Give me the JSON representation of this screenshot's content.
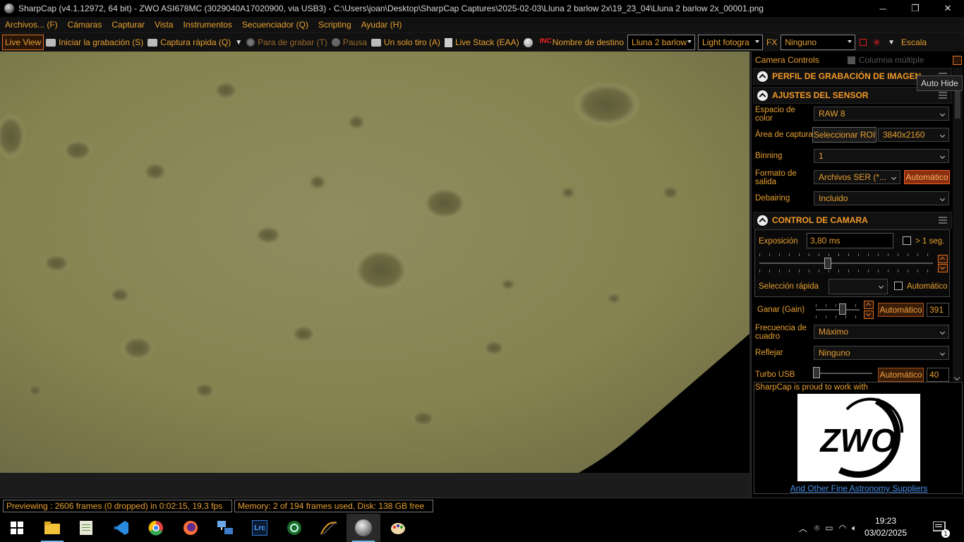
{
  "window": {
    "title": "SharpCap (v4.1.12972, 64 bit) - ZWO ASI678MC (3029040A17020900, via USB3) - C:\\Users\\joan\\Desktop\\SharpCap Captures\\2025-02-03\\Lluna 2 barlow 2x\\19_23_04\\Lluna 2 barlow 2x_00001.png",
    "minimize": "─",
    "maximize": "❐",
    "close": "✕"
  },
  "menu": [
    "Archivos... (F)",
    "Cámaras",
    "Capturar",
    "Vista",
    "Instrumentos",
    "Secuenciador (Q)",
    "Scripting",
    "Ayudar (H)"
  ],
  "toolbar": {
    "live_view": "Live View",
    "start_recording": "Iniciar la grabación (S)",
    "quick_capture": "Captura rápida (Q)",
    "stop_recording": "Para de grabar (T)",
    "pause": "Pausa",
    "single_shot": "Un solo tiro (A)",
    "live_stack": "Live Stack (EAA)",
    "target_name_label": "Nombre de destino",
    "target_name_value": "Lluna 2 barlow",
    "capture_profile": "Light fotogra",
    "fx_label": "FX",
    "fx_value": "Ninguno",
    "scale_label": "Escala"
  },
  "panel": {
    "title": "Camera Controls",
    "multi_column": "Columna múltiple",
    "auto_hide_tooltip": "Auto Hide",
    "sections": {
      "capture_profile": "PERFIL DE GRABACIÓN DE IMAGEN",
      "sensor": "AJUSTES DEL SENSOR",
      "camera_control": "CONTROL DE CAMARA"
    },
    "sensor": {
      "color_space_label": "Espacio de color",
      "color_space_value": "RAW 8",
      "capture_area_label": "Área de captura",
      "select_roi": "Seleccionar ROI",
      "capture_area_value": "3840x2160",
      "binning_label": "Binning",
      "binning_value": "1",
      "output_format_label": "Formato de salida",
      "output_format_value": "Archivos SER (*...",
      "output_auto": "Automático",
      "debayer_label": "Debairing",
      "debayer_value": "Incluido"
    },
    "camera": {
      "exposure_label": "Exposición",
      "exposure_value": "3,80 ms",
      "over_1s": "> 1 seg.",
      "quick_select_label": "Selección rápida",
      "quick_select_value": "",
      "quick_select_auto": "Automático",
      "gain_label": "Ganar (Gain)",
      "gain_auto": "Automático",
      "gain_value": "391",
      "frame_rate_label": "Frecuencia de cuadro",
      "frame_rate_value": "Máximo",
      "flip_label": "Reflejar",
      "flip_value": "Ninguno",
      "usb_turbo_label": "Turbo USB",
      "usb_turbo_auto": "Automático",
      "usb_turbo_value": "40"
    },
    "sponsor": {
      "proud": "SharpCap is proud to work with",
      "logo_text": "ZWO",
      "link": "And Other Fine Astronomy Suppliers"
    }
  },
  "status": {
    "previewing": "Previewing : 2606 frames (0 dropped) in 0:02:15, 19,3 fps",
    "memory": "Memory: 2 of 194 frames used, Disk: 138 GB free"
  },
  "taskbar": {
    "apps": [
      "windows-start",
      "file-explorer",
      "notepad",
      "vscode",
      "chrome",
      "firefox",
      "network-app",
      "lightroom-classic",
      "astro-app",
      "sharpcap-spline",
      "sharpcap",
      "paint"
    ],
    "lrc_label": "Lrc",
    "time": "19:23",
    "date": "03/02/2025",
    "notifications": "1"
  },
  "colors": {
    "accent": "#e8a030",
    "active_border": "#e07020",
    "moon": "#8d8a5c"
  }
}
